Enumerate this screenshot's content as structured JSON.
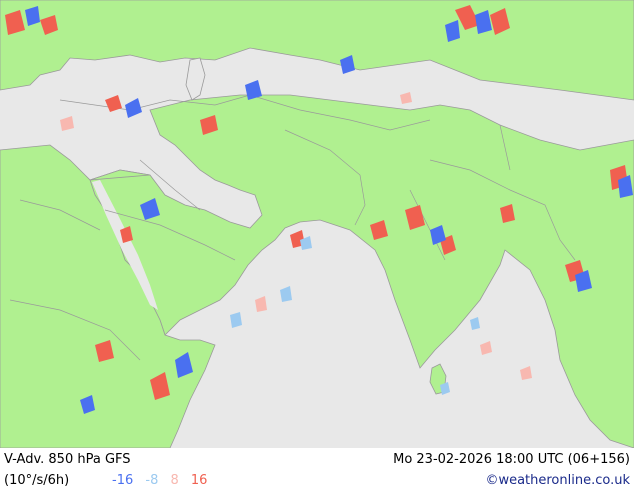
{
  "map": {
    "colors": {
      "sea": "#e8e8e8",
      "land": "#b0f090",
      "border": "#9a9a9a",
      "strong_negative": "#4a70f0",
      "weak_negative": "#9ccaf0",
      "weak_positive": "#f8b8b0",
      "strong_positive": "#f06050"
    }
  },
  "footer": {
    "title": "V-Adv. 850 hPa  GFS",
    "valid_time": "Mo 23-02-2026 18:00 UTC (06+156)",
    "units": "(10°/s/6h)",
    "legend": [
      {
        "label": "-16",
        "color": "#4a70f0"
      },
      {
        "label": "-8",
        "color": "#9ccaf0"
      },
      {
        "label": "8",
        "color": "#f8b8b0"
      },
      {
        "label": "16",
        "color": "#f06050"
      }
    ],
    "credit": "©weatheronline.co.uk"
  }
}
